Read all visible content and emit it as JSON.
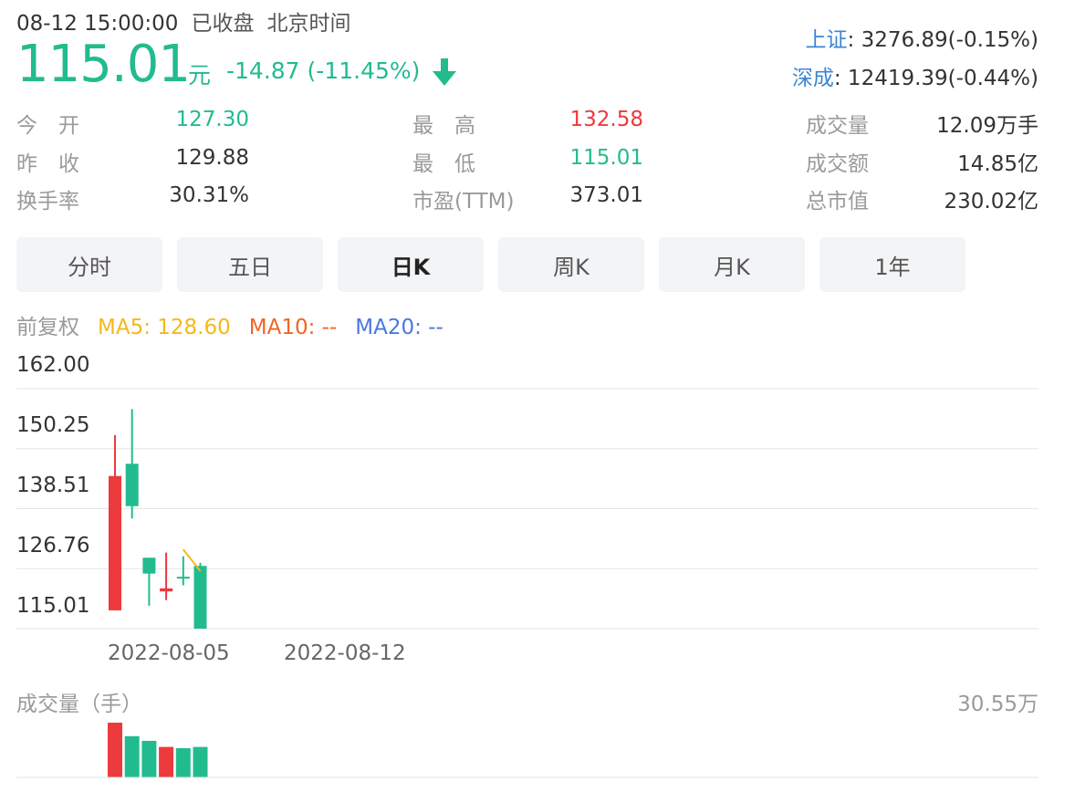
{
  "header": {
    "datetime": "08-12 15:00:00",
    "status": "已收盘",
    "timezone": "北京时间",
    "price": "115.01",
    "unit": "元",
    "change": "-14.87 (-11.45%)",
    "direction_icon": "arrow-down-icon"
  },
  "indices": [
    {
      "name": "上证",
      "value": ": 3276.89(-0.15%)"
    },
    {
      "name": "深成",
      "value": ": 12419.39(-0.44%)"
    }
  ],
  "stats": {
    "open_label": "今　开",
    "open": "127.30",
    "prev_close_label": "昨　收",
    "prev_close": "129.88",
    "turnover_rate_label": "换手率",
    "turnover_rate": "30.31%",
    "high_label": "最　高",
    "high": "132.58",
    "low_label": "最　低",
    "low": "115.01",
    "pe_label": "市盈(TTM)",
    "pe": "373.01",
    "volume_label": "成交量",
    "volume": "12.09万手",
    "amount_label": "成交额",
    "amount": "14.85亿",
    "market_cap_label": "总市值",
    "market_cap": "230.02亿"
  },
  "tabs": [
    {
      "label": "分时",
      "active": false
    },
    {
      "label": "五日",
      "active": false
    },
    {
      "label": "日K",
      "active": true
    },
    {
      "label": "周K",
      "active": false
    },
    {
      "label": "月K",
      "active": false
    },
    {
      "label": "1年",
      "active": false
    }
  ],
  "ma_bar": {
    "adjust": "前复权",
    "ma5": "MA5: 128.60",
    "ma10": "MA10: --",
    "ma20": "MA20: --"
  },
  "colors": {
    "up": "#ec3a3d",
    "down": "#22bb8f",
    "ma5": "#f5b81c",
    "ma10": "#f26522",
    "ma20": "#4a78e0",
    "index_link": "#3a86d6",
    "grid": "#e6e6e6"
  },
  "chart_data": {
    "type": "candlestick",
    "y_ticks": [
      "162.00",
      "150.25",
      "138.51",
      "126.76",
      "115.01"
    ],
    "ylim": [
      115.01,
      162.0
    ],
    "x_ticks": [
      "2022-08-05",
      "2022-08-12"
    ],
    "candles": [
      {
        "open": 118.6,
        "close": 144.9,
        "high": 152.9,
        "low": 118.6,
        "dir": "up"
      },
      {
        "open": 147.3,
        "close": 139.0,
        "high": 158.0,
        "low": 136.6,
        "dir": "down"
      },
      {
        "open": 128.9,
        "close": 125.8,
        "high": 128.9,
        "low": 119.5,
        "dir": "down"
      },
      {
        "open": 122.9,
        "close": 122.3,
        "high": 129.9,
        "low": 120.6,
        "dir": "up"
      },
      {
        "open": 125.0,
        "close": 125.0,
        "high": 129.2,
        "low": 123.5,
        "dir": "flat"
      },
      {
        "open": 127.3,
        "close": 115.01,
        "high": 127.9,
        "low": 115.01,
        "dir": "down"
      }
    ],
    "ma5_line": [
      [
        4,
        130.5
      ],
      [
        5,
        126.3
      ]
    ],
    "volume": {
      "title": "成交量（手）",
      "max_label": "30.55万",
      "values": [
        30.55,
        23.0,
        20.4,
        17.0,
        16.3,
        17.0
      ],
      "dirs": [
        "up",
        "down",
        "down",
        "up",
        "down",
        "down"
      ]
    }
  }
}
